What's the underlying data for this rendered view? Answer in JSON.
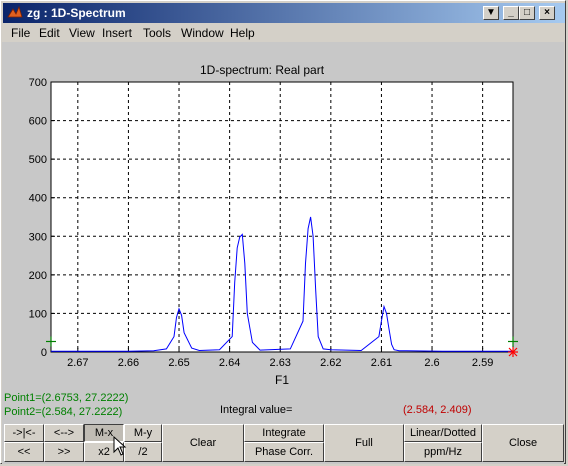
{
  "window": {
    "title": "zg : 1D-Spectrum",
    "controls": [
      "▼",
      "_",
      "□",
      "×"
    ]
  },
  "menu": [
    "File",
    "Edit",
    "View",
    "Insert",
    "Tools",
    "Window",
    "Help"
  ],
  "plot": {
    "title": "1D-spectrum: Real part",
    "xlabel": "F1",
    "line_color": "#0000ff",
    "marker_color": "#008000",
    "end_marker_color": "#ff0000"
  },
  "chart_data": {
    "type": "line",
    "title": "1D-spectrum: Real part",
    "xlabel": "F1",
    "ylabel": "",
    "xlim": [
      2.6753,
      2.584
    ],
    "ylim": [
      0,
      700
    ],
    "xticks": [
      "2.67",
      "2.66",
      "2.65",
      "2.64",
      "2.63",
      "2.62",
      "2.61",
      "2.6",
      "2.59"
    ],
    "yticks": [
      "0",
      "100",
      "200",
      "300",
      "400",
      "500",
      "600",
      "700"
    ],
    "grid": true,
    "x": [
      2.6753,
      2.66,
      2.655,
      2.6525,
      2.651,
      2.6505,
      2.65,
      2.6495,
      2.649,
      2.6475,
      2.646,
      2.642,
      2.6395,
      2.639,
      2.6385,
      2.638,
      2.6375,
      2.637,
      2.6365,
      2.6355,
      2.634,
      2.628,
      2.6255,
      2.625,
      2.6245,
      2.624,
      2.6235,
      2.623,
      2.6225,
      2.6215,
      2.62,
      2.614,
      2.6105,
      2.61,
      2.6095,
      2.609,
      2.6085,
      2.608,
      2.6075,
      2.6065,
      2.605,
      2.598,
      2.594,
      2.59,
      2.584
    ],
    "y": [
      2,
      2,
      3,
      8,
      40,
      90,
      112,
      95,
      50,
      10,
      4,
      6,
      40,
      180,
      270,
      298,
      305,
      230,
      100,
      25,
      5,
      8,
      80,
      230,
      320,
      350,
      300,
      160,
      40,
      8,
      6,
      4,
      40,
      80,
      118,
      100,
      60,
      20,
      6,
      3,
      3,
      2,
      2,
      2,
      2
    ],
    "markers": [
      {
        "x": 2.6753,
        "y": 27.2222,
        "color": "green"
      },
      {
        "x": 2.584,
        "y": 27.2222,
        "color": "green"
      },
      {
        "x": 2.584,
        "y": 0,
        "color": "red"
      }
    ]
  },
  "info": {
    "point1": "Point1=(2.6753, 27.2222)",
    "point2": "Point2=(2.584, 27.2222)",
    "integral_label": "Integral value=",
    "integral_value": "(2.584, 2.409)",
    "point_color": "#008000",
    "value_color": "#c00000"
  },
  "buttons": {
    "zoom_out_x": "->|<-",
    "pan": "<-->",
    "mx": "M-x",
    "my": "M-y",
    "left": "<<",
    "right": ">>",
    "x2": "x2",
    "div2": "/2",
    "clear": "Clear",
    "integrate": "Integrate",
    "phase": "Phase Corr.",
    "full": "Full",
    "linear": "Linear/Dotted",
    "ppm": "ppm/Hz",
    "close": "Close"
  }
}
